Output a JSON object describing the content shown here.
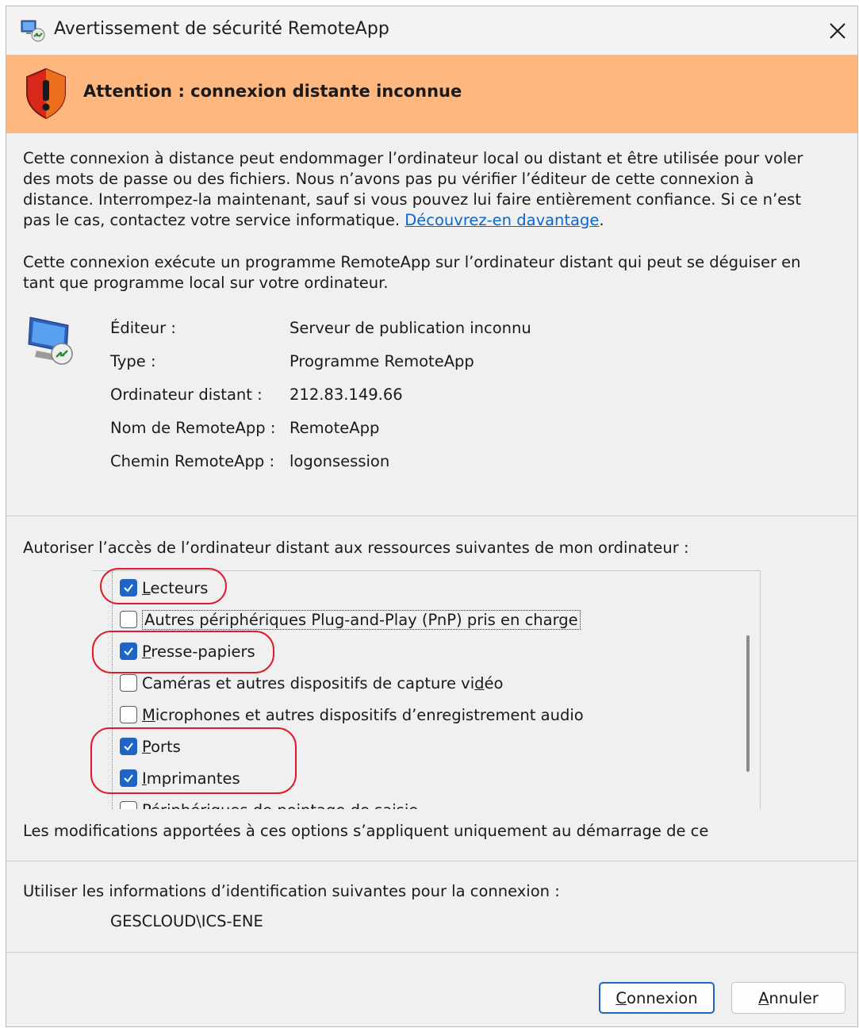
{
  "window": {
    "title": "Avertissement de sécurité RemoteApp",
    "icon": "remoteapp-icon",
    "close_icon": "close-icon"
  },
  "banner": {
    "icon": "warning-shield-icon",
    "text": "Attention : connexion distante inconnue",
    "color": "#fdb77f"
  },
  "intro": {
    "text": "Cette connexion à distance peut endommager l’ordinateur local ou distant et être utilisée pour voler des mots de passe ou des fichiers. Nous n’avons pas pu vérifier l’éditeur de cette connexion à distance. Interrompez-la maintenant, sauf si vous pouvez lui faire entièrement confiance. Si ce n’est pas le cas, contactez votre service informatique. ",
    "link": "Découvrez-en davantage",
    "after_link": "."
  },
  "description": "Cette connexion exécute un programme RemoteApp sur l’ordinateur distant qui peut se déguiser en tant que programme local sur votre ordinateur.",
  "details": {
    "icon": "remote-computer-icon",
    "rows": [
      {
        "label": "Éditeur :",
        "value": "Serveur de publication inconnu"
      },
      {
        "label": "Type :",
        "value": "Programme RemoteApp"
      },
      {
        "label": "Ordinateur distant :",
        "value": "212.83.149.66"
      },
      {
        "label": "Nom de RemoteApp :",
        "value": "RemoteApp"
      },
      {
        "label": "Chemin RemoteApp :",
        "value": "logonsession"
      }
    ]
  },
  "resources": {
    "label": "Autoriser l’accès de l’ordinateur distant aux ressources suivantes de mon ordinateur :",
    "items": [
      {
        "u": "L",
        "rest": "ecteurs",
        "checked": true
      },
      {
        "pre": "Autres périphériques Plug-and-Play (PnP) pris en charge",
        "checked": false
      },
      {
        "u": "P",
        "rest": "resse-papiers",
        "checked": true
      },
      {
        "pre": "Caméras et autres dispositifs de capture vi",
        "u": "d",
        "rest": "éo",
        "checked": false
      },
      {
        "u": "M",
        "rest": "icrophones et autres dispositifs d’enregistrement audio",
        "checked": false
      },
      {
        "u": "P",
        "rest": "orts",
        "checked": true
      },
      {
        "u": "I",
        "rest": "mprimantes",
        "checked": true
      },
      {
        "pre": "Périphériques de pointage de saisie",
        "checked": false
      }
    ],
    "highlight_color": "#e11a2b",
    "check_color": "#1f66c4"
  },
  "note": "Les modifications apportées à ces options s’appliquent uniquement au démarrage de cette",
  "credentials": {
    "label": "Utiliser les informations d’identification suivantes pour la connexion :",
    "value": "GESCLOUD\\ICS-ENE"
  },
  "buttons": {
    "connect_u": "C",
    "connect_rest": "onnexion",
    "cancel_u": "A",
    "cancel_rest": "nnuler"
  }
}
